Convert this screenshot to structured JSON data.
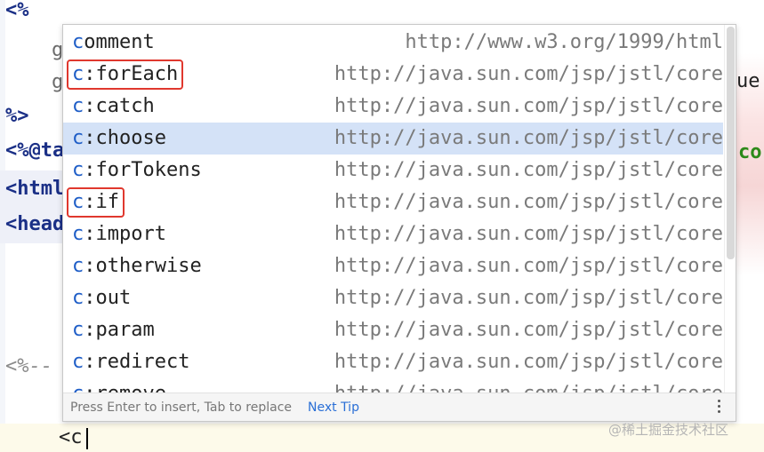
{
  "editor": {
    "lines": [
      {
        "text": "<%"
      },
      {
        "text": "%>"
      },
      {
        "text": "<%@ta"
      },
      {
        "text": "<html"
      },
      {
        "text": "<head"
      },
      {
        "text": "<%--"
      },
      {
        "text": "<c"
      }
    ],
    "right_fragment_1": "ue",
    "right_fragment_2": "co"
  },
  "popup": {
    "items": [
      {
        "prefix": "c",
        "rest": "omment",
        "url": "http://www.w3.org/1999/html",
        "selected": false,
        "marked": false
      },
      {
        "prefix": "c",
        "rest": ":forEach",
        "url": "http://java.sun.com/jsp/jstl/core",
        "selected": false,
        "marked": true
      },
      {
        "prefix": "c",
        "rest": ":catch",
        "url": "http://java.sun.com/jsp/jstl/core",
        "selected": false,
        "marked": false
      },
      {
        "prefix": "c",
        "rest": ":choose",
        "url": "http://java.sun.com/jsp/jstl/core",
        "selected": true,
        "marked": false
      },
      {
        "prefix": "c",
        "rest": ":forTokens",
        "url": "http://java.sun.com/jsp/jstl/core",
        "selected": false,
        "marked": false
      },
      {
        "prefix": "c",
        "rest": ":if",
        "url": "http://java.sun.com/jsp/jstl/core",
        "selected": false,
        "marked": true
      },
      {
        "prefix": "c",
        "rest": ":import",
        "url": "http://java.sun.com/jsp/jstl/core",
        "selected": false,
        "marked": false
      },
      {
        "prefix": "c",
        "rest": ":otherwise",
        "url": "http://java.sun.com/jsp/jstl/core",
        "selected": false,
        "marked": false
      },
      {
        "prefix": "c",
        "rest": ":out",
        "url": "http://java.sun.com/jsp/jstl/core",
        "selected": false,
        "marked": false
      },
      {
        "prefix": "c",
        "rest": ":param",
        "url": "http://java.sun.com/jsp/jstl/core",
        "selected": false,
        "marked": false
      },
      {
        "prefix": "c",
        "rest": ":redirect",
        "url": "http://java.sun.com/jsp/jstl/core",
        "selected": false,
        "marked": false
      },
      {
        "prefix": "c",
        "rest": ":remove",
        "url": "http://java.sun.com/jsp/jstl/core",
        "selected": false,
        "marked": false
      }
    ],
    "footer_hint": "Press Enter to insert, Tab to replace",
    "footer_link": "Next Tip",
    "more_icon": "more-vertical-icon"
  },
  "watermark": "@稀土掘金技术社区",
  "colors": {
    "selection": "#d4e2f7",
    "prefix_match": "#1f5ec7",
    "annotation_box": "#e0382e",
    "link": "#2a6fd6"
  }
}
